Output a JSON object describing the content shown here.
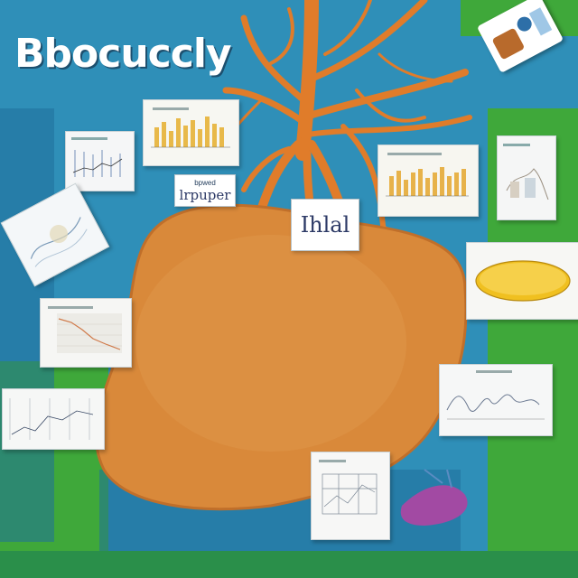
{
  "title": "Bbocuccly",
  "label_card_1": {
    "line1": "bpwed",
    "line2": "lrpuper"
  },
  "label_card_2": {
    "text": "Ihlal"
  },
  "illustration": {
    "subject": "organ-with-branching-vessels",
    "colors": {
      "background": "#2f8fb8",
      "accent": "#3fa83a",
      "organ": "#d9893a",
      "vessels": "#e07c2a"
    }
  }
}
